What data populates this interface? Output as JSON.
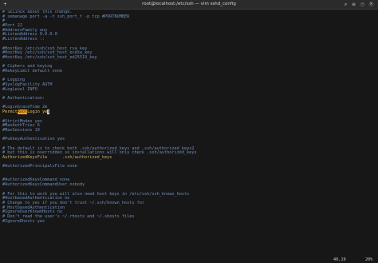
{
  "window": {
    "title": "root@localhost:/etc/ssh — vim sshd_config"
  },
  "editor": {
    "lines": [
      "# SELinux about this change.",
      "# semanage port -a -t ssh_port_t -p tcp #PORTNUMBER",
      "#",
      "#Port 22",
      "#AddressFamily any",
      "#ListenAddress 0.0.0.0",
      "#ListenAddress ::",
      "",
      "#HostKey /etc/ssh/ssh_host_rsa_key",
      "#HostKey /etc/ssh/ssh_host_ecdsa_key",
      "#HostKey /etc/ssh/ssh_host_ed25519_key",
      "",
      "# Ciphers and keying",
      "#RekeyLimit default none",
      "",
      "# Logging",
      "#SyslogFacility AUTH",
      "#LogLevel INFO",
      "",
      "# Authentication:",
      "",
      "#LoginGraceTime 2m",
      "",
      "#StrictModes yes",
      "#MaxAuthTries 6",
      "#MaxSessions 10",
      "",
      "#PubkeyAuthentication yes",
      "",
      "# The default is to check both .ssh/authorized_keys and .ssh/authorized_keys2",
      "# but this is overridden so installations will only check .ssh/authorized_keys",
      "AuthorizedKeysFile      .ssh/authorized_keys",
      "",
      "#AuthorizedPrincipalsFile none",
      "",
      "",
      "#AuthorizedKeysCommand none",
      "#AuthorizedKeysCommandUser nobody",
      "",
      "# For this to work you will also need host keys in /etc/ssh/ssh_known_hosts",
      "#HostbasedAuthentication no",
      "# Change to yes if you don't trust ~/.ssh/known_hosts for",
      "# HostbasedAuthentication",
      "#IgnoreUserKnownHosts no",
      "# Don't read the user's ~/.rhosts and ~/.shosts files",
      "#IgnoreRhosts yes"
    ],
    "active_line": {
      "before": "PermitRoot",
      "match": "Root",
      "after": "Login ye",
      "cursor": "s"
    }
  },
  "status": {
    "position": "40,19",
    "percent": "20%"
  },
  "colors": {
    "background": "#171717",
    "comment": "#6f8fbd",
    "keyword": "#e0c862",
    "search_match": "#f0a020"
  }
}
